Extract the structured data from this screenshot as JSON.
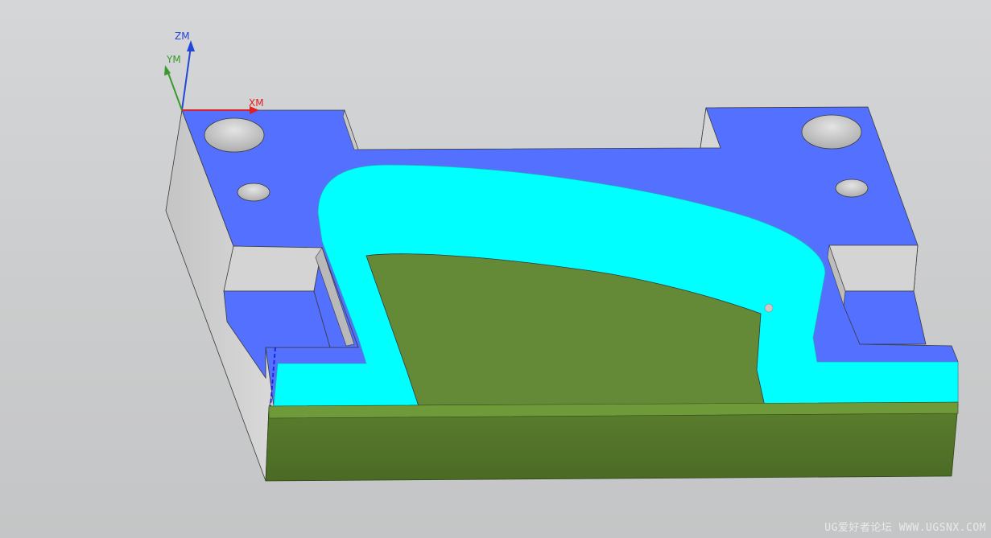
{
  "viewport": {
    "background_top": "#d5d6d8",
    "background_bottom": "#c4c5c6"
  },
  "triad": {
    "z_label": "ZM",
    "y_label": "YM",
    "x_label": "XM",
    "z_color": "#2146d8",
    "y_color": "#3a9a2a",
    "x_color": "#e02020"
  },
  "model": {
    "colors": {
      "top_face": "#5470ff",
      "fillet_face": "#00ffff",
      "cavity_face": "#658a37",
      "front_face": "#4f7128",
      "side_face": "#d2d2d2",
      "hole": "#c9c9c9",
      "edge": "#3a3a3a"
    }
  },
  "watermark": "UG爱好者论坛 WWW.UGSNX.COM"
}
